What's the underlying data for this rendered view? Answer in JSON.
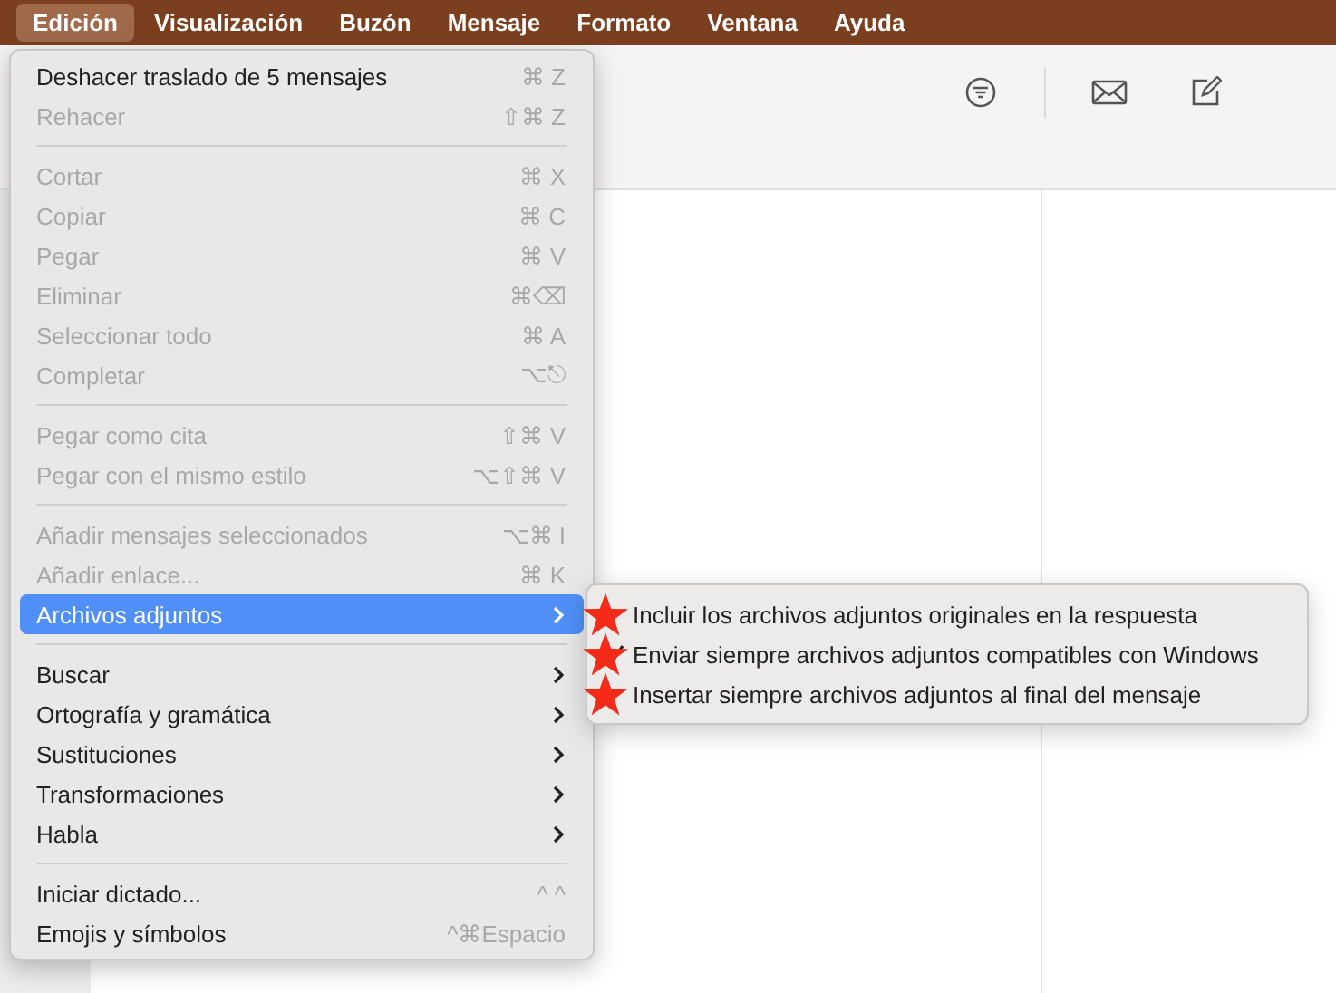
{
  "menu_bar": {
    "items": [
      {
        "label": "Edición",
        "selected": true
      },
      {
        "label": "Visualización",
        "selected": false
      },
      {
        "label": "Buzón",
        "selected": false
      },
      {
        "label": "Mensaje",
        "selected": false
      },
      {
        "label": "Formato",
        "selected": false
      },
      {
        "label": "Ventana",
        "selected": false
      },
      {
        "label": "Ayuda",
        "selected": false
      }
    ]
  },
  "edit_menu": {
    "items": [
      {
        "kind": "item",
        "label": "Deshacer traslado de 5 mensajes",
        "shortcut": "⌘ Z",
        "disabled": false,
        "selected": false,
        "submenu": false
      },
      {
        "kind": "item",
        "label": "Rehacer",
        "shortcut": "⇧⌘ Z",
        "disabled": true,
        "selected": false,
        "submenu": false
      },
      {
        "kind": "separator"
      },
      {
        "kind": "item",
        "label": "Cortar",
        "shortcut": "⌘ X",
        "disabled": true,
        "selected": false,
        "submenu": false
      },
      {
        "kind": "item",
        "label": "Copiar",
        "shortcut": "⌘ C",
        "disabled": true,
        "selected": false,
        "submenu": false
      },
      {
        "kind": "item",
        "label": "Pegar",
        "shortcut": "⌘ V",
        "disabled": true,
        "selected": false,
        "submenu": false
      },
      {
        "kind": "item",
        "label": "Eliminar",
        "shortcut": "⌘⌫",
        "disabled": true,
        "selected": false,
        "submenu": false
      },
      {
        "kind": "item",
        "label": "Seleccionar todo",
        "shortcut": "⌘ A",
        "disabled": true,
        "selected": false,
        "submenu": false
      },
      {
        "kind": "item",
        "label": "Completar",
        "shortcut": "⌥⎋",
        "disabled": true,
        "selected": false,
        "submenu": false
      },
      {
        "kind": "separator"
      },
      {
        "kind": "item",
        "label": "Pegar como cita",
        "shortcut": "⇧⌘ V",
        "disabled": true,
        "selected": false,
        "submenu": false
      },
      {
        "kind": "item",
        "label": "Pegar con el mismo estilo",
        "shortcut": "⌥⇧⌘ V",
        "disabled": true,
        "selected": false,
        "submenu": false
      },
      {
        "kind": "separator"
      },
      {
        "kind": "item",
        "label": "Añadir mensajes seleccionados",
        "shortcut": "⌥⌘ I",
        "disabled": true,
        "selected": false,
        "submenu": false
      },
      {
        "kind": "item",
        "label": "Añadir enlace...",
        "shortcut": "⌘ K",
        "disabled": true,
        "selected": false,
        "submenu": false
      },
      {
        "kind": "item",
        "label": "Archivos adjuntos",
        "disabled": false,
        "selected": true,
        "submenu": true
      },
      {
        "kind": "separator"
      },
      {
        "kind": "item",
        "label": "Buscar",
        "disabled": false,
        "selected": false,
        "submenu": true
      },
      {
        "kind": "item",
        "label": "Ortografía y gramática",
        "disabled": false,
        "selected": false,
        "submenu": true
      },
      {
        "kind": "item",
        "label": "Sustituciones",
        "disabled": false,
        "selected": false,
        "submenu": true
      },
      {
        "kind": "item",
        "label": "Transformaciones",
        "disabled": false,
        "selected": false,
        "submenu": true
      },
      {
        "kind": "item",
        "label": "Habla",
        "disabled": false,
        "selected": false,
        "submenu": true
      },
      {
        "kind": "separator"
      },
      {
        "kind": "item",
        "label": "Iniciar dictado...",
        "shortcut": "^ ^",
        "disabled": false,
        "selected": false,
        "submenu": false
      },
      {
        "kind": "item",
        "label": "Emojis y símbolos",
        "shortcut": "^⌘Espacio",
        "disabled": false,
        "selected": false,
        "submenu": false
      }
    ]
  },
  "attachments_submenu": {
    "items": [
      {
        "label": "Incluir los archivos adjuntos originales en la respuesta",
        "checked": false,
        "starred": true
      },
      {
        "label": "Enviar siempre archivos adjuntos compatibles con Windows",
        "checked": true,
        "starred": true
      },
      {
        "label": "Insertar siempre archivos adjuntos al final del mensaje",
        "checked": false,
        "starred": true
      }
    ]
  }
}
